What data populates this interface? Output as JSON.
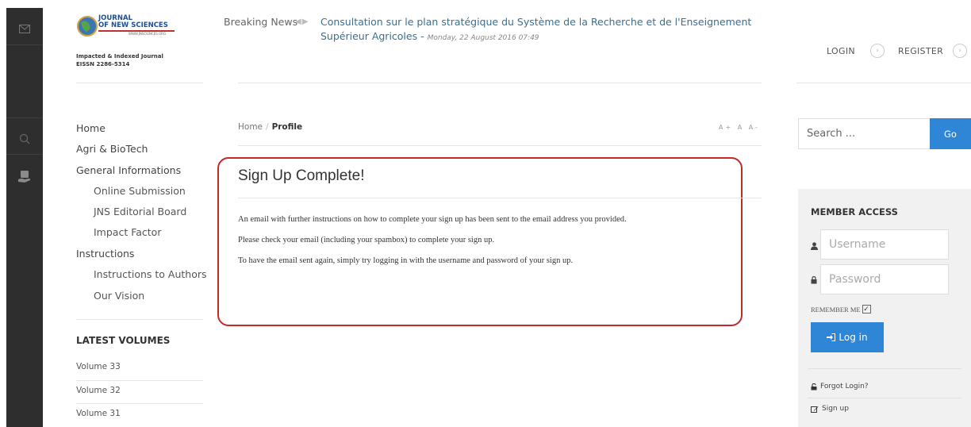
{
  "header": {
    "logo_line1": "JOURNAL",
    "logo_line2": "OF NEW SCIENCES",
    "logo_url": "WWW.JNSCIENCES.ORG",
    "tagline": "Impacted & Indexed Journal",
    "eissn": "EISSN 2286-5314"
  },
  "breaking_news": {
    "label": "Breaking News",
    "arrows": "◀▶",
    "title": "Consultation sur le plan stratégique du Système de la Recherche et de l'Enseignement Supérieur Agricoles -",
    "date": "Monday, 22 August 2016 07:49"
  },
  "auth": {
    "login": "LOGIN",
    "register": "REGISTER",
    "arrow": "›"
  },
  "nav": {
    "items": [
      {
        "label": "Home"
      },
      {
        "label": "Agri & BioTech"
      },
      {
        "label": "General Informations"
      },
      {
        "label": "Online Submission"
      },
      {
        "label": "JNS Editorial Board"
      },
      {
        "label": "Impact Factor"
      },
      {
        "label": "Instructions"
      },
      {
        "label": "Instructions to Authors"
      },
      {
        "label": "Our Vision"
      }
    ]
  },
  "latest_volumes": {
    "heading": "LATEST VOLUMES",
    "items": [
      "Volume 33",
      "Volume 32",
      "Volume 31"
    ]
  },
  "breadcrumb": {
    "home": "Home",
    "separator": "/",
    "current": "Profile"
  },
  "font_tools": "A+ A A-",
  "signup": {
    "title": "Sign Up Complete!",
    "messages": [
      "An email with further instructions on how to complete your sign up has been sent to the email address you provided.",
      "Please check your email (including your spambox) to complete your sign up.",
      "To have the email sent again, simply try logging in with the username and password of your sign up."
    ]
  },
  "search": {
    "placeholder": "Search ...",
    "button": "Go"
  },
  "member_access": {
    "title": "MEMBER ACCESS",
    "username_placeholder": "Username",
    "password_placeholder": "Password",
    "remember_me": "REMEMBER ME",
    "login_button": "Log in",
    "forgot": "Forgot Login?",
    "signup": "Sign up"
  },
  "colors": {
    "accent": "#2f86d6",
    "highlight_border": "#c12a2a",
    "rail": "#2e2e2e"
  }
}
